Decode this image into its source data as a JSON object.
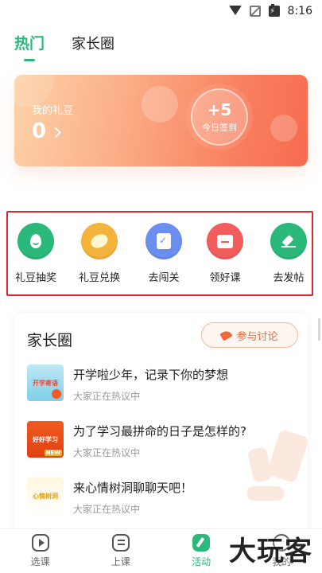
{
  "status_bar": {
    "time": "8:16"
  },
  "top_tabs": [
    {
      "label": "热门",
      "active": true
    },
    {
      "label": "家长圈",
      "active": false
    }
  ],
  "beans": {
    "title": "我的礼豆",
    "value": "0",
    "checkin_plus": "+5",
    "checkin_label": "今日签到"
  },
  "actions": [
    {
      "label": "礼豆抽奖",
      "icon": "drop-icon",
      "color": "#2bb87b"
    },
    {
      "label": "礼豆兑换",
      "icon": "bean-icon",
      "color": "#f4b33b"
    },
    {
      "label": "去闯关",
      "icon": "clipboard-icon",
      "color": "#6a8ff0"
    },
    {
      "label": "领好课",
      "icon": "gift-icon",
      "color": "#f15d5d"
    },
    {
      "label": "去发帖",
      "icon": "pencil-icon",
      "color": "#2bb87b"
    }
  ],
  "parents": {
    "title": "家长圈",
    "join_label": "参与讨论",
    "topics": [
      {
        "title": "开学啦少年，记录下你的梦想",
        "sub": "大家正在热议中",
        "thumb_text": "开学寄语"
      },
      {
        "title": "为了学习最拼命的日子是怎样的?",
        "sub": "大家正在热议中",
        "thumb_text": "好好学习",
        "badge": "NEW"
      },
      {
        "title": "来心情树洞聊聊天吧！",
        "sub": "大家正在热议中",
        "thumb_text": "心情树洞"
      }
    ]
  },
  "bottom_nav": [
    {
      "label": "选课",
      "icon": "play-icon",
      "active": false
    },
    {
      "label": "上课",
      "icon": "list-icon",
      "active": false
    },
    {
      "label": "活动",
      "icon": "activity-icon",
      "active": true
    },
    {
      "label": "我的",
      "icon": "me-icon",
      "active": false
    }
  ],
  "watermark": "大玩客",
  "colors": {
    "accent": "#2bb87b",
    "highlight_border": "#d9262c",
    "orange": "#ee6a3c"
  }
}
